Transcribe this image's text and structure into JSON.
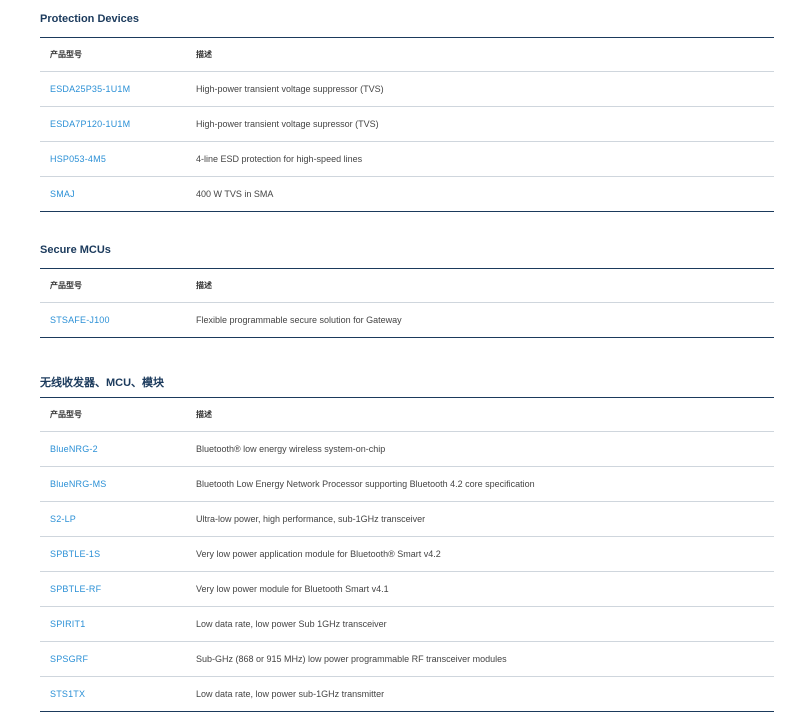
{
  "colors": {
    "heading": "#1b3a5c",
    "link": "#2b90d6",
    "rule": "#1b3a5c",
    "divider": "#cfd6dd"
  },
  "sections": [
    {
      "title": "Protection Devices",
      "headers": {
        "part": "产品型号",
        "desc": "描述"
      },
      "rows": [
        {
          "part": "ESDA25P35-1U1M",
          "desc": "High-power transient voltage suppressor (TVS)"
        },
        {
          "part": "ESDA7P120-1U1M",
          "desc": "High-power transient voltage supressor (TVS)"
        },
        {
          "part": "HSP053-4M5",
          "desc": "4-line ESD protection for high-speed lines"
        },
        {
          "part": "SMAJ",
          "desc": "400 W TVS in SMA"
        }
      ]
    },
    {
      "title": "Secure MCUs",
      "headers": {
        "part": "产品型号",
        "desc": "描述"
      },
      "rows": [
        {
          "part": "STSAFE-J100",
          "desc": "Flexible programmable secure solution for Gateway"
        }
      ]
    },
    {
      "title": "无线收发器、MCU、模块",
      "headers": {
        "part": "产品型号",
        "desc": "描述"
      },
      "rows": [
        {
          "part": "BlueNRG-2",
          "desc": "Bluetooth® low energy wireless system-on-chip"
        },
        {
          "part": "BlueNRG-MS",
          "desc": "Bluetooth Low Energy Network Processor supporting Bluetooth 4.2 core specification"
        },
        {
          "part": "S2-LP",
          "desc": "Ultra-low power, high performance, sub-1GHz transceiver"
        },
        {
          "part": "SPBTLE-1S",
          "desc": "Very low power application module for Bluetooth® Smart v4.2"
        },
        {
          "part": "SPBTLE-RF",
          "desc": "Very low power module for Bluetooth Smart v4.1"
        },
        {
          "part": "SPIRIT1",
          "desc": "Low data rate, low power Sub 1GHz transceiver"
        },
        {
          "part": "SPSGRF",
          "desc": "Sub-GHz (868 or 915 MHz) low power programmable RF transceiver modules"
        },
        {
          "part": "STS1TX",
          "desc": "Low data rate, low power sub-1GHz transmitter"
        }
      ]
    }
  ]
}
